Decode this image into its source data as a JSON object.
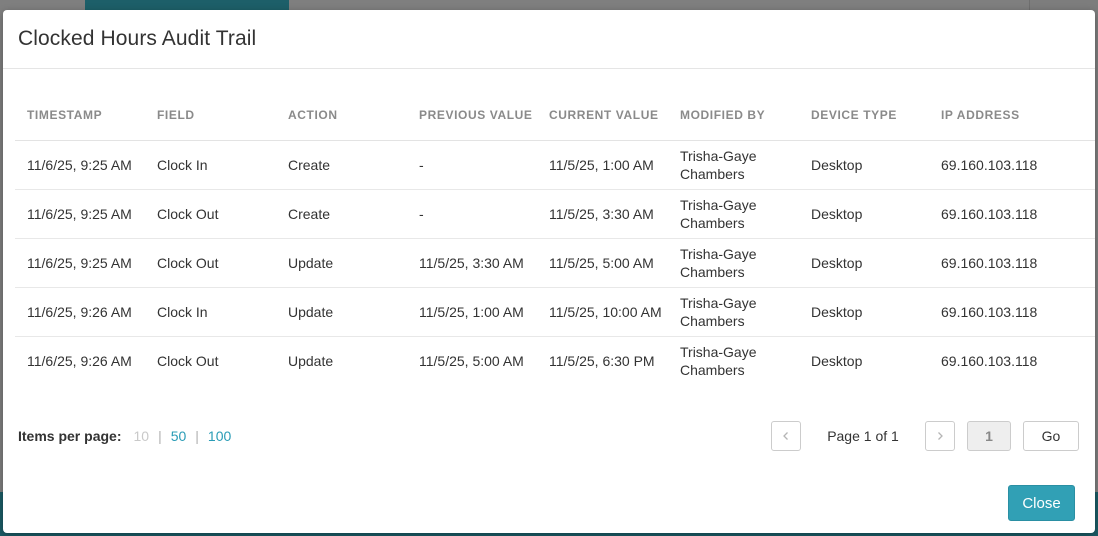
{
  "modal": {
    "title": "Clocked Hours Audit Trail",
    "close_label": "Close"
  },
  "table": {
    "headers": [
      "TIMESTAMP",
      "FIELD",
      "ACTION",
      "PREVIOUS VALUE",
      "CURRENT VALUE",
      "MODIFIED BY",
      "DEVICE TYPE",
      "IP ADDRESS"
    ],
    "rows": [
      [
        "11/6/25, 9:25 AM",
        "Clock In",
        "Create",
        "-",
        "11/5/25, 1:00 AM",
        "Trisha-Gaye Chambers",
        "Desktop",
        "69.160.103.118"
      ],
      [
        "11/6/25, 9:25 AM",
        "Clock Out",
        "Create",
        "-",
        "11/5/25, 3:30 AM",
        "Trisha-Gaye Chambers",
        "Desktop",
        "69.160.103.118"
      ],
      [
        "11/6/25, 9:25 AM",
        "Clock Out",
        "Update",
        "11/5/25, 3:30 AM",
        "11/5/25, 5:00 AM",
        "Trisha-Gaye Chambers",
        "Desktop",
        "69.160.103.118"
      ],
      [
        "11/6/25, 9:26 AM",
        "Clock In",
        "Update",
        "11/5/25, 1:00 AM",
        "11/5/25, 10:00 AM",
        "Trisha-Gaye Chambers",
        "Desktop",
        "69.160.103.118"
      ],
      [
        "11/6/25, 9:26 AM",
        "Clock Out",
        "Update",
        "11/5/25, 5:00 AM",
        "11/5/25, 6:30 PM",
        "Trisha-Gaye Chambers",
        "Desktop",
        "69.160.103.118"
      ]
    ]
  },
  "pager": {
    "items_per_page_label": "Items per page:",
    "options": [
      "10",
      "50",
      "100"
    ],
    "selected_option": "10",
    "separator": "|",
    "page_info": "Page 1 of 1",
    "page_input_value": "1",
    "go_label": "Go",
    "prev_icon": "chevron-left-icon",
    "next_icon": "chevron-right-icon"
  },
  "colors": {
    "accent": "#31a0b5",
    "link": "#2a9cb6",
    "header_text": "#8a8a8a",
    "body_text": "#333333"
  }
}
